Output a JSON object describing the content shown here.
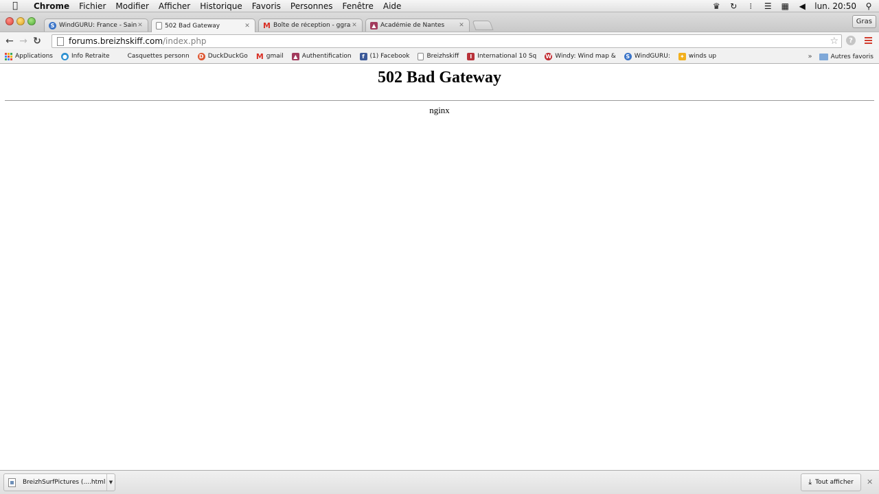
{
  "menubar": {
    "app": "Chrome",
    "items": [
      "Fichier",
      "Modifier",
      "Afficher",
      "Historique",
      "Favoris",
      "Personnes",
      "Fenêtre",
      "Aide"
    ],
    "clock": "lun. 20:50"
  },
  "tabs": [
    {
      "title": "WindGURU: France - Saint",
      "favicon_color": "#3a74c8",
      "favicon": "windguru-icon",
      "active": false
    },
    {
      "title": "502 Bad Gateway",
      "favicon_color": "#ffffff",
      "favicon": "page-icon",
      "active": true
    },
    {
      "title": "Boîte de réception - ggras",
      "favicon_color": "#d93025",
      "favicon": "gmail-icon",
      "active": false
    },
    {
      "title": "Académie de Nantes",
      "favicon_color": "#a23a5c",
      "favicon": "academie-icon",
      "active": false
    }
  ],
  "profile_button": "Gras",
  "omnibox": {
    "host": "forums.breizhskiff.com",
    "path": "/index.php"
  },
  "bookmarks": [
    {
      "label": "Applications",
      "icon": "apps-grid-icon"
    },
    {
      "label": "Info Retraite",
      "icon": "info-retraite-icon",
      "color": "#2b8fd0"
    },
    {
      "label": "Casquettes personn",
      "icon": "blank-icon",
      "color": "#ffffff"
    },
    {
      "label": "DuckDuckGo",
      "icon": "duckduckgo-icon",
      "color": "#de5833"
    },
    {
      "label": "gmail",
      "icon": "gmail-icon",
      "color": "#d93025"
    },
    {
      "label": "Authentification",
      "icon": "academie-icon",
      "color": "#a23a5c"
    },
    {
      "label": "(1) Facebook",
      "icon": "facebook-icon",
      "color": "#3b5998"
    },
    {
      "label": "Breizhskiff",
      "icon": "page-icon",
      "color": "#ffffff"
    },
    {
      "label": "International 10 Sq",
      "icon": "international-icon",
      "color": "#b8323a"
    },
    {
      "label": "Windy: Wind map &",
      "icon": "windy-icon",
      "color": "#c0272d"
    },
    {
      "label": "WindGURU:",
      "icon": "windguru-icon",
      "color": "#3a74c8"
    },
    {
      "label": "winds up",
      "icon": "winds-up-icon",
      "color": "#f2b01e"
    }
  ],
  "other_bookmarks": "Autres favoris",
  "page": {
    "heading": "502 Bad Gateway",
    "server": "nginx"
  },
  "downloads": {
    "file": "BreizhSurfPictures (....html",
    "show_all": "Tout afficher"
  }
}
